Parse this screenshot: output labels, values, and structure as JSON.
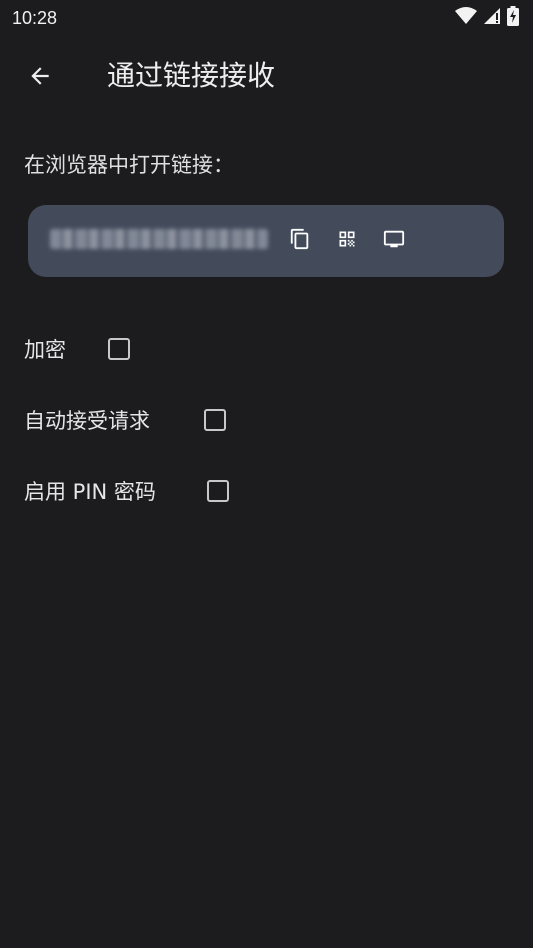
{
  "status_bar": {
    "time": "10:28",
    "icons": [
      "wifi-icon",
      "cellular-signal-icon",
      "battery-charging-icon"
    ]
  },
  "app_bar": {
    "back_icon": "arrow-back-icon",
    "title": "通过链接接收"
  },
  "instruction": "在浏览器中打开链接：",
  "link_box": {
    "link_text": "",
    "actions": [
      "copy-icon",
      "qr-code-icon",
      "monitor-icon"
    ]
  },
  "options": [
    {
      "label": "加密",
      "checked": false
    },
    {
      "label": "自动接受请求",
      "checked": false
    },
    {
      "label": "启用 PIN 密码",
      "checked": false
    }
  ],
  "colors": {
    "background": "#1c1c1e",
    "link_box": "#434b5b",
    "text": "#e6e6e6"
  }
}
